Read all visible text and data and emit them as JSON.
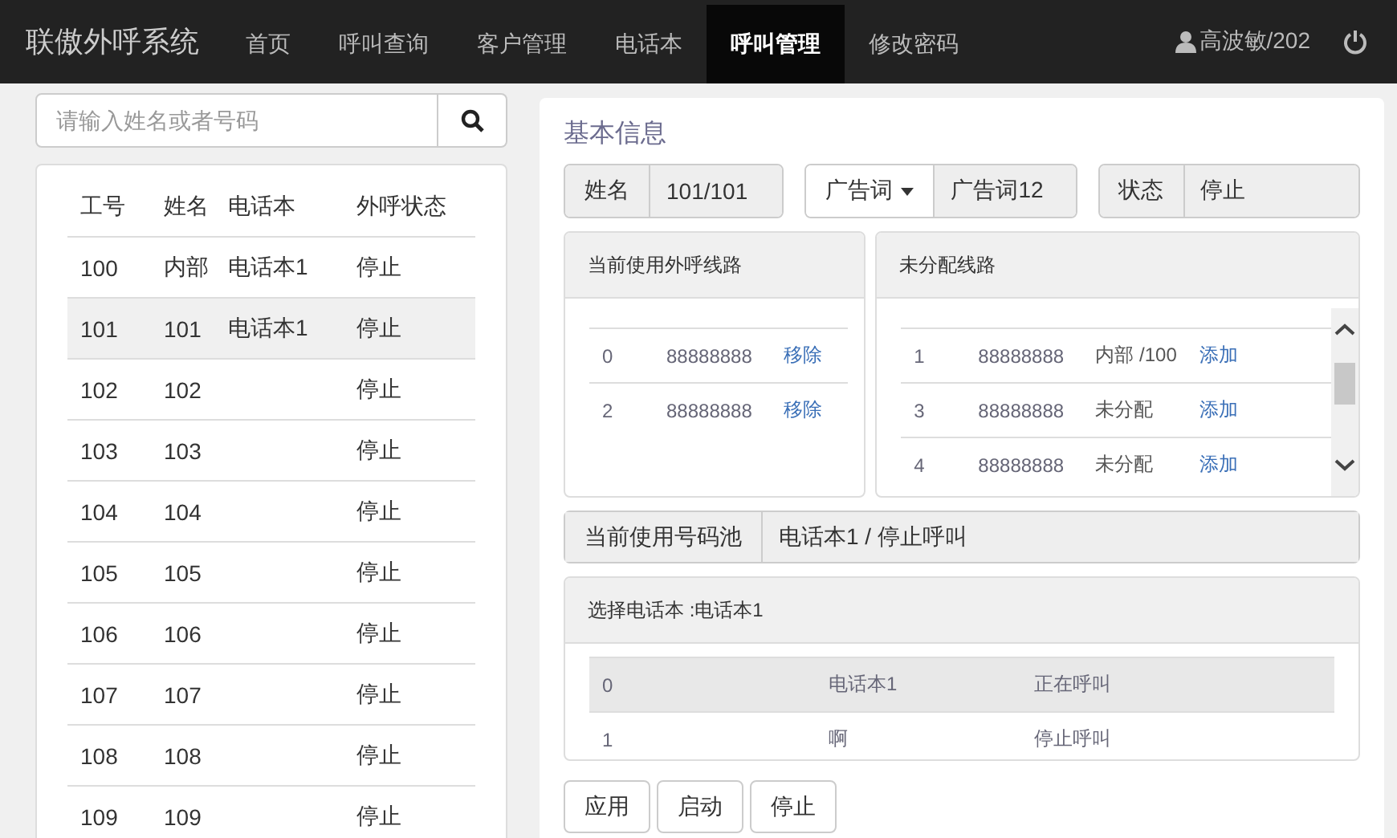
{
  "navbar": {
    "brand": "联傲外呼系统",
    "items": [
      {
        "label": "首页",
        "selected": false
      },
      {
        "label": "呼叫查询",
        "selected": false
      },
      {
        "label": "客户管理",
        "selected": false
      },
      {
        "label": "电话本",
        "selected": false
      },
      {
        "label": "呼叫管理",
        "selected": true
      },
      {
        "label": "修改密码",
        "selected": false
      }
    ],
    "user": "高波敏/202"
  },
  "search": {
    "placeholder": "请输入姓名或者号码"
  },
  "agents": {
    "columns": [
      "工号",
      "姓名",
      "电话本",
      "外呼状态"
    ],
    "rows": [
      {
        "cells": [
          "100",
          "内部",
          "电话本1",
          "停止"
        ],
        "selected": false
      },
      {
        "cells": [
          "101",
          "101",
          "电话本1",
          "停止"
        ],
        "selected": true
      },
      {
        "cells": [
          "102",
          "102",
          "",
          "停止"
        ],
        "selected": false
      },
      {
        "cells": [
          "103",
          "103",
          "",
          "停止"
        ],
        "selected": false
      },
      {
        "cells": [
          "104",
          "104",
          "",
          "停止"
        ],
        "selected": false
      },
      {
        "cells": [
          "105",
          "105",
          "",
          "停止"
        ],
        "selected": false
      },
      {
        "cells": [
          "106",
          "106",
          "",
          "停止"
        ],
        "selected": false
      },
      {
        "cells": [
          "107",
          "107",
          "",
          "停止"
        ],
        "selected": false
      },
      {
        "cells": [
          "108",
          "108",
          "",
          "停止"
        ],
        "selected": false
      },
      {
        "cells": [
          "109",
          "109",
          "",
          "停止"
        ],
        "selected": false
      }
    ]
  },
  "basic_info": {
    "title": "基本信息",
    "name_label": "姓名",
    "name_value": "101/101",
    "ad_dropdown": "广告词",
    "ad_value": "广告词12",
    "status_label": "状态",
    "status_value": "停止"
  },
  "current_lines": {
    "title": "当前使用外呼线路",
    "rows": [
      {
        "cells": [
          "0",
          "88888888"
        ],
        "action": "移除"
      },
      {
        "cells": [
          "2",
          "88888888"
        ],
        "action": "移除"
      }
    ]
  },
  "unassigned_lines": {
    "title": "未分配线路",
    "rows": [
      {
        "cells": [
          "1",
          "88888888",
          "内部 /100"
        ],
        "action": "添加"
      },
      {
        "cells": [
          "3",
          "88888888",
          "未分配"
        ],
        "action": "添加"
      },
      {
        "cells": [
          "4",
          "88888888",
          "未分配"
        ],
        "action": "添加"
      }
    ]
  },
  "number_pool": {
    "label": "当前使用号码池",
    "value": "电话本1 / 停止呼叫"
  },
  "phonebooks": {
    "title": "选择电话本 :电话本1",
    "rows": [
      {
        "cells": [
          "0",
          "电话本1",
          "正在呼叫"
        ],
        "selected": true
      },
      {
        "cells": [
          "1",
          "啊",
          "停止呼叫"
        ],
        "selected": false
      }
    ]
  },
  "buttons": [
    "应用",
    "启动",
    "停止"
  ]
}
